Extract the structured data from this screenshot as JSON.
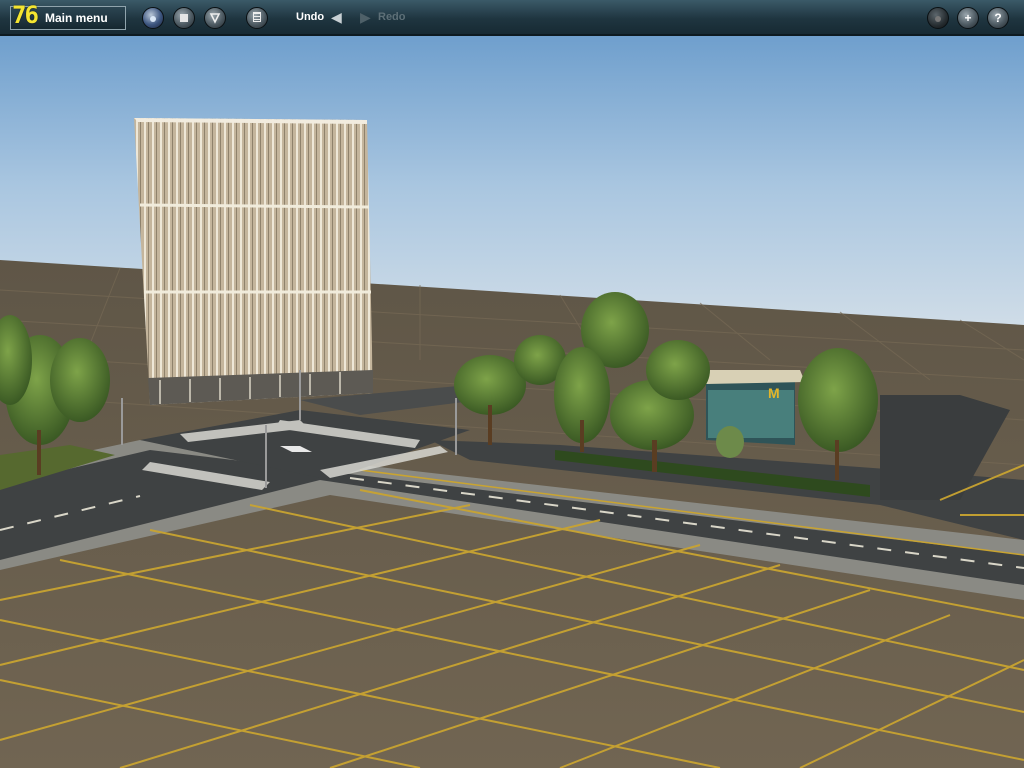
{
  "toolbar": {
    "fps_counter": "76",
    "main_menu_label": "Main menu",
    "undo_label": "Undo",
    "redo_label": "Redo",
    "help_glyph": "?",
    "zoom_glyph": "+"
  },
  "icons": {
    "left_group": [
      "world-globe-icon",
      "stop-icon",
      "settings-icon",
      "calendar-icon"
    ],
    "right_group": [
      "camera-icon",
      "zoom-in-icon",
      "help-icon"
    ]
  },
  "colors": {
    "toolbar": "#1f3540",
    "fps_text": "#f4e531",
    "sky_top": "#79a6d3",
    "ground": "#6b5f4d",
    "grid_line": "#c9a431",
    "road": "#3f4243"
  }
}
